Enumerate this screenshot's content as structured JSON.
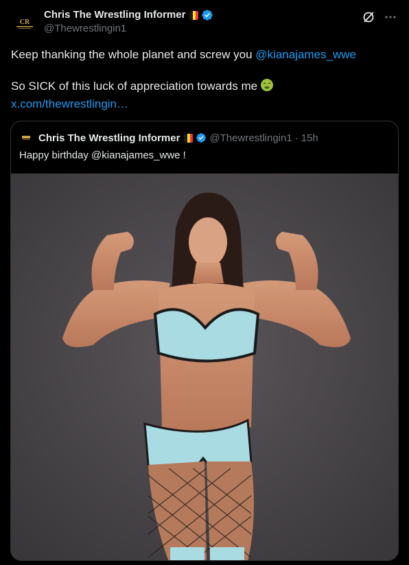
{
  "author": {
    "display_name": "Chris The Wrestling Informer",
    "handle": "@Thewrestlingin1",
    "avatar_text": "CR"
  },
  "tweet": {
    "line1_prefix": "Keep thanking the whole planet and screw you ",
    "line1_mention": "@kianajames_wwe",
    "line2": "So SICK of this luck of appreciation towards me",
    "emoji": "nauseated-face-icon",
    "link": "x.com/thewrestlingin…"
  },
  "quoted_tweet": {
    "display_name": "Chris The Wrestling Informer",
    "handle": "@Thewrestlingin1",
    "separator": "·",
    "time": "15h",
    "text": "Happy birthday @kianajames_wwe !",
    "image_subject": "photo-wrestler-flexing"
  },
  "colors": {
    "background": "#000000",
    "text": "#e7e9ea",
    "secondary": "#71767b",
    "accent": "#1d9bf0",
    "border": "#2f3336",
    "photo_bg": "#4a474b",
    "outfit": "#a9dbe3"
  },
  "icons": [
    "grok-icon",
    "more-icon",
    "verified-badge-icon",
    "belgium-flag-icon"
  ]
}
